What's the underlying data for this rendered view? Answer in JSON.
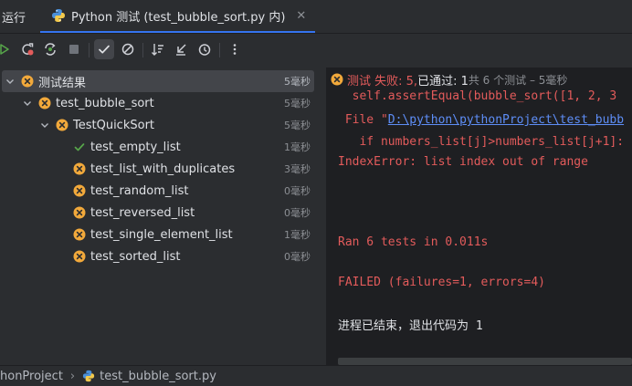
{
  "header": {
    "run_label": "运行",
    "tab_title": "Python 测试 (test_bubble_sort.py 内)",
    "tab_close": "✕"
  },
  "toolbar": {
    "icons": [
      "rerun-icon",
      "rerun-failed-icon",
      "toggle-auto-test-icon",
      "stop-icon",
      "show-passed-icon",
      "show-ignored-icon",
      "sort-icon",
      "collapse-icon",
      "history-icon",
      "more-icon"
    ]
  },
  "tree": {
    "items": [
      {
        "label": "测试结果",
        "time": "5毫秒",
        "status": "fail",
        "depth": 0,
        "expanded": true,
        "selected": true
      },
      {
        "label": "test_bubble_sort",
        "time": "5毫秒",
        "status": "fail",
        "depth": 1,
        "expanded": true
      },
      {
        "label": "TestQuickSort",
        "time": "5毫秒",
        "status": "fail",
        "depth": 2,
        "expanded": true
      },
      {
        "label": "test_empty_list",
        "time": "1毫秒",
        "status": "pass",
        "depth": 3
      },
      {
        "label": "test_list_with_duplicates",
        "time": "3毫秒",
        "status": "fail",
        "depth": 3
      },
      {
        "label": "test_random_list",
        "time": "0毫秒",
        "status": "fail",
        "depth": 3
      },
      {
        "label": "test_reversed_list",
        "time": "0毫秒",
        "status": "fail",
        "depth": 3
      },
      {
        "label": "test_single_element_list",
        "time": "1毫秒",
        "status": "fail",
        "depth": 3
      },
      {
        "label": "test_sorted_list",
        "time": "0毫秒",
        "status": "fail",
        "depth": 3
      }
    ]
  },
  "console": {
    "status": {
      "failed": "测试 失败: 5,",
      "passed": "已通过: 1",
      "summary": "共 6 个测试 – 5毫秒"
    },
    "lines": {
      "l1": "  self.assertEqual(bubble_sort([1, 2, 3",
      "l2_pre": " File \"",
      "l2_link": "D:\\python\\pythonProject\\test_bubb",
      "l3": "   if numbers_list[j]>numbers_list[j+1]:",
      "l4": "IndexError: list index out of range",
      "l5": "Ran 6 tests in 0.011s",
      "l6": "FAILED (failures=1, errors=4)",
      "l7": "进程已结束，退出代码为 1"
    }
  },
  "breadcrumb": {
    "project": "honProject",
    "separator": "›",
    "file": "test_bubble_sort.py"
  },
  "colors": {
    "fail": "#f2a93b",
    "pass": "#57a64a",
    "error_text": "#e35b5b",
    "link": "#5e8ef7"
  }
}
